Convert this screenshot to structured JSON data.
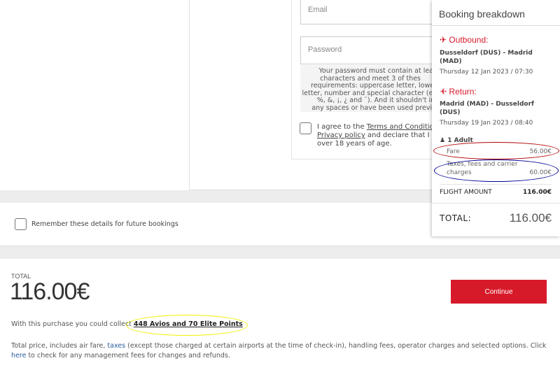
{
  "form": {
    "email_placeholder": "Email",
    "password_placeholder": "Password",
    "password_hint_lines": [
      "Your password must contain at lea",
      "characters and meet 3 of thes",
      "requirements: uppercase letter, lowerc",
      "letter, number and special character (exc",
      "%, &, ¡, ¿ and ¨). And it shouldn't incl",
      "any spaces or have been used previou"
    ],
    "agree_prefix": "I agree to the ",
    "terms_link": "Terms and Condition",
    "privacy_link": "Privacy policy",
    "agree_mid": " and declare that I an",
    "agree_end": "over 18 years of age."
  },
  "remember_label": "Remember these details for future bookings",
  "booking": {
    "title": "Booking breakdown",
    "outbound_label": "Outbound:",
    "outbound_route": "Dusseldorf (DUS) - Madrid (MAD)",
    "outbound_date": "Thursday 12 Jan 2023 / 07:30",
    "return_label": "Return:",
    "return_route": "Madrid (MAD) - Dusseldorf (DUS)",
    "return_date": "Thursday 19 Jan 2023 / 08:40",
    "passengers": "1 Adult",
    "fare_label": "Fare",
    "fare_value": "56.00€",
    "taxes_label": "Taxes, fees and carrier charges",
    "taxes_value": "60.00€",
    "flight_amount_label": "FLIGHT AMOUNT",
    "flight_amount_value": "116.00€",
    "total_label": "TOTAL:",
    "total_value": "116.00€"
  },
  "summary": {
    "total_label": "TOTAL",
    "total_value": "116.00€",
    "continue_label": "Continue",
    "collect_text": "With this purchase you could collect ",
    "collect_link": "448 Avios and 70 Elite Points",
    "note_1": "Total price, includes air fare, ",
    "taxes_link": "taxes",
    "note_2": " (except those charged at certain airports at the time of check-in), handling fees, operator charges and selected options. Click ",
    "here_link": "here",
    "note_3": " to check for any management fees for changes and refunds."
  },
  "colors": {
    "accent": "#d71a2a",
    "link": "#2a5d9f",
    "annotation_red": "#b00000",
    "annotation_blue": "#000099",
    "annotation_yellow": "#f0f000"
  }
}
